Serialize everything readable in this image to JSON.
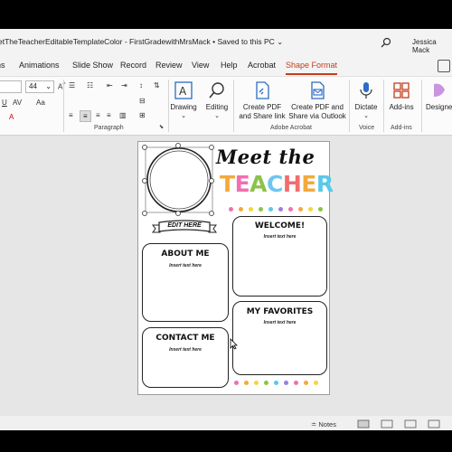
{
  "window": {
    "title": "etTheTeacherEditableTemplateColor - FirstGradewithMrsMack • Saved to this PC ⌄",
    "user": "Jessica Mack"
  },
  "tabs": [
    {
      "label": "ns"
    },
    {
      "label": "Animations"
    },
    {
      "label": "Slide Show"
    },
    {
      "label": "Record"
    },
    {
      "label": "Review"
    },
    {
      "label": "View"
    },
    {
      "label": "Help"
    },
    {
      "label": "Acrobat"
    },
    {
      "label": "Shape Format"
    }
  ],
  "ribbon": {
    "font_size": "44",
    "font_name_partial": "",
    "paragraph_label": "Paragraph",
    "drawing_label": "Drawing",
    "editing_label": "Editing",
    "create_pdf_share_link": "Create PDF and Share link",
    "create_pdf_outlook": "Create PDF and Share via Outlook",
    "acrobat_group_label": "Adobe Acrobat",
    "dictate_label": "Dictate",
    "voice_group_label": "Voice",
    "addins_label": "Add-ins",
    "addins_group_label": "Add-ins",
    "designer_label": "Designer"
  },
  "slide": {
    "heading_line1": "Meet the",
    "heading_line2_letters": [
      "T",
      "E",
      "A",
      "C",
      "H",
      "E",
      "R"
    ],
    "heading_line2_colors": [
      "#f4a93c",
      "#f16fb0",
      "#8bc34a",
      "#6ec6f0",
      "#f26d6d",
      "#f4a93c",
      "#5bc8e8"
    ],
    "edit_banner": "EDIT HERE",
    "about_title": "ABOUT ME",
    "about_sub": "Insert text here",
    "contact_title": "CONTACT ME",
    "contact_sub": "Insert text here",
    "welcome_title": "WELCOME!",
    "welcome_sub": "Insert text here",
    "favorites_title": "MY FAVORITES",
    "favorites_sub": "Insert text here",
    "dot_colors": [
      "#f16fb0",
      "#f4a93c",
      "#f6d53a",
      "#8bc34a",
      "#5bc8e8",
      "#9b7fe0",
      "#f16fb0",
      "#f4a93c",
      "#f6d53a",
      "#8bc34a",
      "#5bc8e8",
      "#9b7fe0",
      "#f16fb0"
    ]
  },
  "status": {
    "notes_label": "Notes"
  }
}
